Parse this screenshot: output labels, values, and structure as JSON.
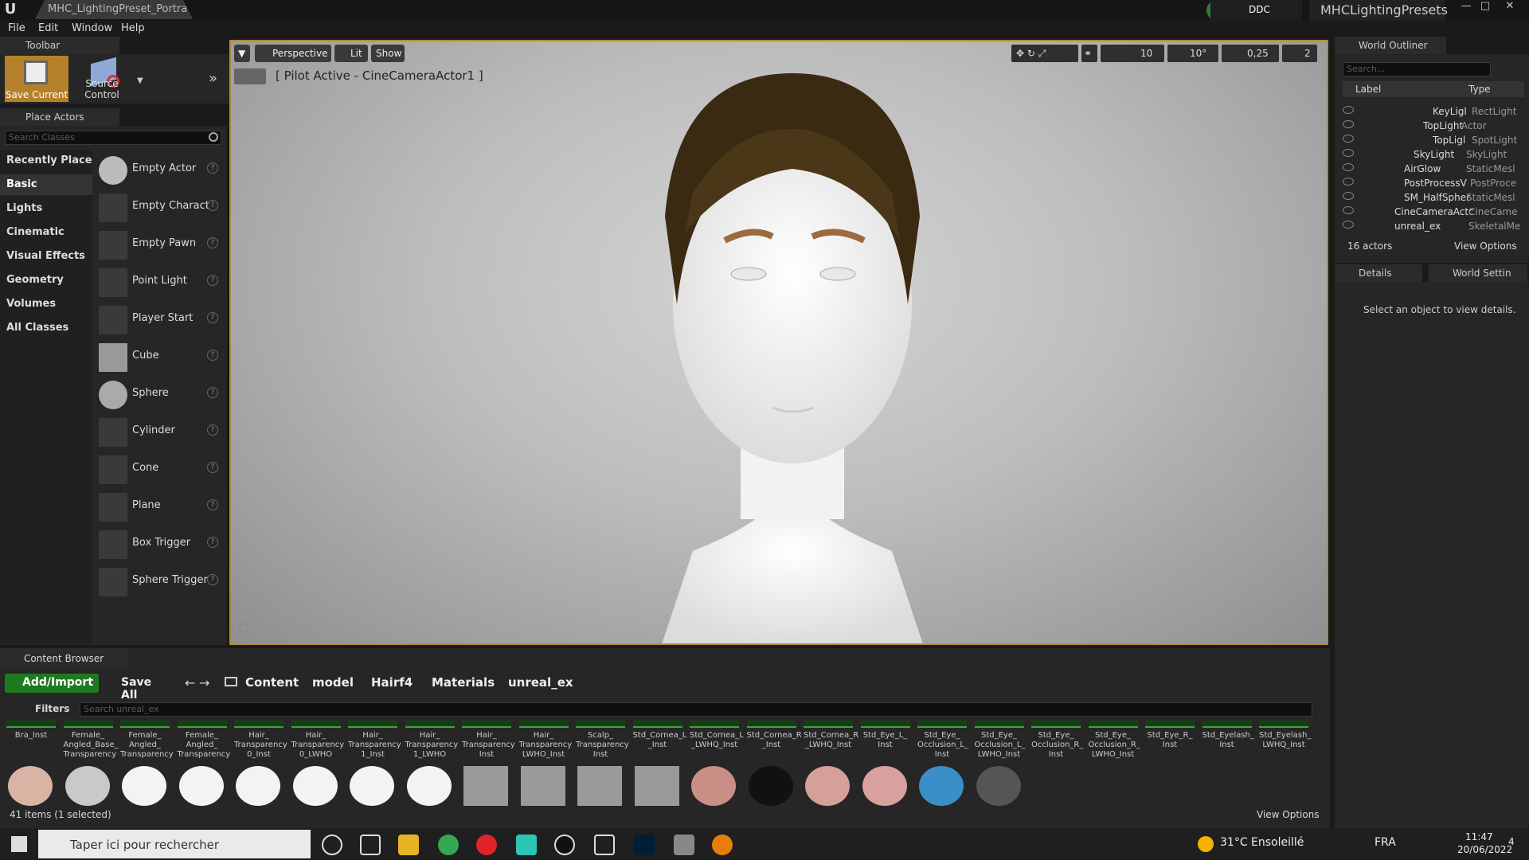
{
  "title_bar": {
    "doc_tab": "MHC_LightingPreset_Portra•",
    "ddc_label": "DDC",
    "project_name": "MHCLightingPresets"
  },
  "menu": [
    "File",
    "Edit",
    "Window",
    "Help"
  ],
  "toolbar": {
    "tab_label": "Toolbar",
    "save_current": "Save Current",
    "source_control": "Source Control"
  },
  "place_actors": {
    "tab_label": "Place Actors",
    "search_placeholder": "Search Classes",
    "categories": [
      "Recently Placed",
      "Basic",
      "Lights",
      "Cinematic",
      "Visual Effects",
      "Geometry",
      "Volumes",
      "All Classes"
    ],
    "selected_category": "Basic",
    "actors": [
      "Empty Actor",
      "Empty Charact",
      "Empty Pawn",
      "Point Light",
      "Player Start",
      "Cube",
      "Sphere",
      "Cylinder",
      "Cone",
      "Plane",
      "Box Trigger",
      "Sphere Trigger"
    ]
  },
  "viewport": {
    "perspective": "Perspective",
    "lit": "Lit",
    "show": "Show",
    "pilot_label": "[ Pilot Active - CineCameraActor1 ]",
    "grid_snap": "10",
    "rot_snap": "10°",
    "scale_snap": "0,25",
    "camera_speed": "2"
  },
  "outliner": {
    "tab_label": "World Outliner",
    "search_placeholder": "Search...",
    "col_label": "Label",
    "col_type": "Type",
    "rows": [
      {
        "label": "KeyLigl",
        "type": "RectLight"
      },
      {
        "label": "TopLight",
        "type": "Actor"
      },
      {
        "label": "TopLigl",
        "type": "SpotLight"
      },
      {
        "label": "SkyLight",
        "type": "SkyLight"
      },
      {
        "label": "AirGlow",
        "type": "StaticMesl"
      },
      {
        "label": "PostProcessV",
        "type": "PostProce"
      },
      {
        "label": "SM_HalfSpher",
        "type": "StaticMesl"
      },
      {
        "label": "CineCameraActc",
        "type": "CineCame"
      },
      {
        "label": "unreal_ex",
        "type": "SkeletalMe"
      }
    ],
    "actor_count": "16 actors",
    "view_options": "View Options"
  },
  "details": {
    "tab_details": "Details",
    "tab_world": "World Settin",
    "empty_msg": "Select an object to view details."
  },
  "content_browser": {
    "tab_label": "Content Browser",
    "add_import": "Add/Import",
    "save_all": "Save All",
    "breadcrumb": [
      "Content",
      "model",
      "Hairf4",
      "Materials",
      "unreal_ex"
    ],
    "filters": "Filters",
    "search_placeholder": "Search unreal_ex",
    "labels_row1": [
      "Bra_Inst",
      "Female_ Angled_Base_ Transparency",
      "Female_ Angled_ Transparency",
      "Female_ Angled_ Transparency",
      "Hair_ Transparency 0_Inst",
      "Hair_ Transparency 0_LWHO",
      "Hair_ Transparency 1_Inst",
      "Hair_ Transparency 1_LWHO",
      "Hair_ Transparency Inst",
      "Hair_ Transparency LWHO_Inst",
      "Scalp_ Transparency Inst",
      "Std_Cornea_L _Inst",
      "Std_Cornea_L _LWHQ_Inst",
      "Std_Cornea_R _Inst",
      "Std_Cornea_R _LWHQ_Inst",
      "Std_Eye_L_ Inst",
      "Std_Eye_ Occlusion_L_ Inst",
      "Std_Eye_ Occlusion_L_ LWHO_Inst",
      "Std_Eye_ Occlusion_R_ Inst",
      "Std_Eye_ Occlusion_R_ LWHO_Inst",
      "Std_Eye_R_ Inst",
      "Std_Eyelash_ Inst",
      "Std_Eyelash_ LWHQ_Inst"
    ],
    "status": "41 items (1 selected)",
    "view_options": "View Options"
  },
  "taskbar": {
    "search_text": "Taper ici pour rechercher",
    "weather": "31°C Ensoleillé",
    "lang": "FRA",
    "time": "11:47",
    "date": "20/06/2022",
    "notif": "4"
  }
}
